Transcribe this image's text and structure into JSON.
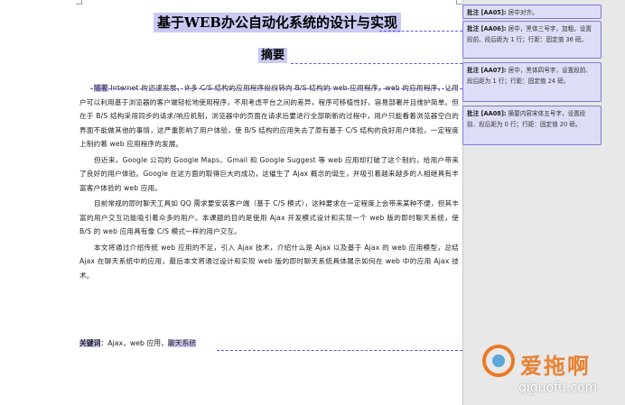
{
  "document": {
    "title": "基于WEB办公自动化系统的设计与实现",
    "abstract_heading": "摘要",
    "paragraph1_lead": "随着",
    "paragraph1": " Internet 的迅速发展，许多 C/S 结构的应用程序纷纷转向 B/S 结构的 web 应用程序。web 的应用程序，让用户可以利用基于浏览器的客户端轻松地使用程序，不用考虑平台之间的差异，程序可移植性好，容易部署并且维护简单。但在于 B/S 结构采用同步的请求/响应机制，浏览器中的页面在请求后要进行全部刷新的过程中，用户只能看着浏览器空白的界面不能做其他的事情，这严重影响了用户体验，使 B/S 结构的应用失去了原有基于 C/S 结构的良好用户体验，一定程度上制约着 web 应用程序的发展。",
    "paragraph2": "但近来，Google 公司的 Google Maps、Gmail 和 Google Suggest 等 web 应用却打破了这个制约，给用户带来了良好的用户体验。Google 在这方面的取得巨大的成功，这催生了 Ajax 概念的诞生，并吸引着越来越多的人相继具有丰富客户体验的 web 应用。",
    "paragraph3": "目前常规的即时聊天工具如 QQ 需求要安装客户端（基于 C/S 模式），这种要求在一定程度上会带来某种不便，但其丰富的用户交互功能吸引着众多的用户。本课题的目的是使用 Ajax 开发模式设计和实现一个 web 版的即时聊天系统，使 B/S 的 web 应用具有像 C/S 模式一样的用户交互。",
    "paragraph4": "本文将通过介绍传统 web 应用的不足，引入 Ajax 技术，介绍什么是 Ajax 以及基于 Ajax 的 web 应用模型，总结 Ajax 在聊天系统中的应用，最后本文将通过设计和实现 web 版的即时聊天系统具体展示如何在 web 中的应用 Ajax 技术。",
    "keywords_label": "关键词",
    "keywords_sep": "：",
    "keywords_values": "Ajax，web 应用，",
    "keywords_last": "聊天系统"
  },
  "comments": [
    {
      "label": "批注 [AA05]:",
      "text": "居中对齐。"
    },
    {
      "label": "批注 [AA06]:",
      "text": "居中，黑体三号字，加粗，设置段前、段后距为 1 行；行距：固定值 36 磅。"
    },
    {
      "label": "批注 [AA07]:",
      "text": "居中，黑体四号字，设置段前、段后距为 1 行；行距：固定值 24 磅。"
    },
    {
      "label": "批注 [AA08]:",
      "text": "摘要内容宋体五号字，设置段前、段后距为 0 行；行距：固定值 20 磅。"
    }
  ],
  "watermark": {
    "text": "爱拖啊",
    "url": "qiguofu.com"
  },
  "colors": {
    "highlight": "#c9c9f3",
    "comment_border": "#7b7bd8",
    "comment_fill": "#ddddf7",
    "watermark_orange": "#e97a25"
  }
}
